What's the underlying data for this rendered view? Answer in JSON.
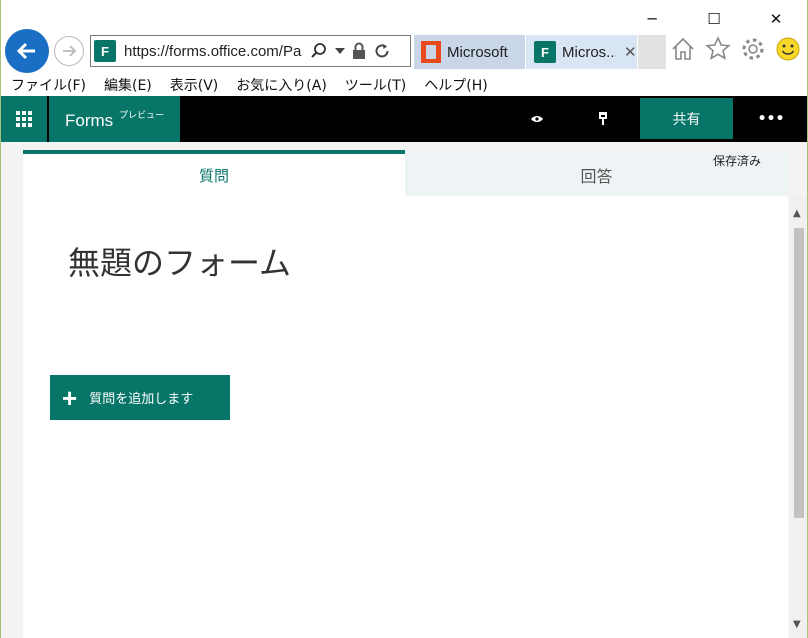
{
  "window": {
    "controls": [
      "─",
      "☐",
      "✕"
    ]
  },
  "browser": {
    "address_url": "https://forms.office.com/Pa",
    "tabs": [
      {
        "label": "Microsoft ..."
      },
      {
        "label": "Micros...",
        "close": "✕"
      }
    ]
  },
  "menu": {
    "items": [
      "ファイル(F)",
      "編集(E)",
      "表示(V)",
      "お気に入り(A)",
      "ツール(T)",
      "ヘルプ(H)"
    ]
  },
  "forms_header": {
    "app_name": "Forms",
    "badge": "プレビュー",
    "share_label": "共有",
    "more_label": "•••"
  },
  "tabs": {
    "questions": "質問",
    "responses": "回答"
  },
  "status": {
    "saved": "保存済み"
  },
  "form": {
    "title": "無題のフォーム",
    "add_question_label": "質問を追加します"
  },
  "colors": {
    "accent": "#077568",
    "ie_blue": "#1a6fc4"
  }
}
